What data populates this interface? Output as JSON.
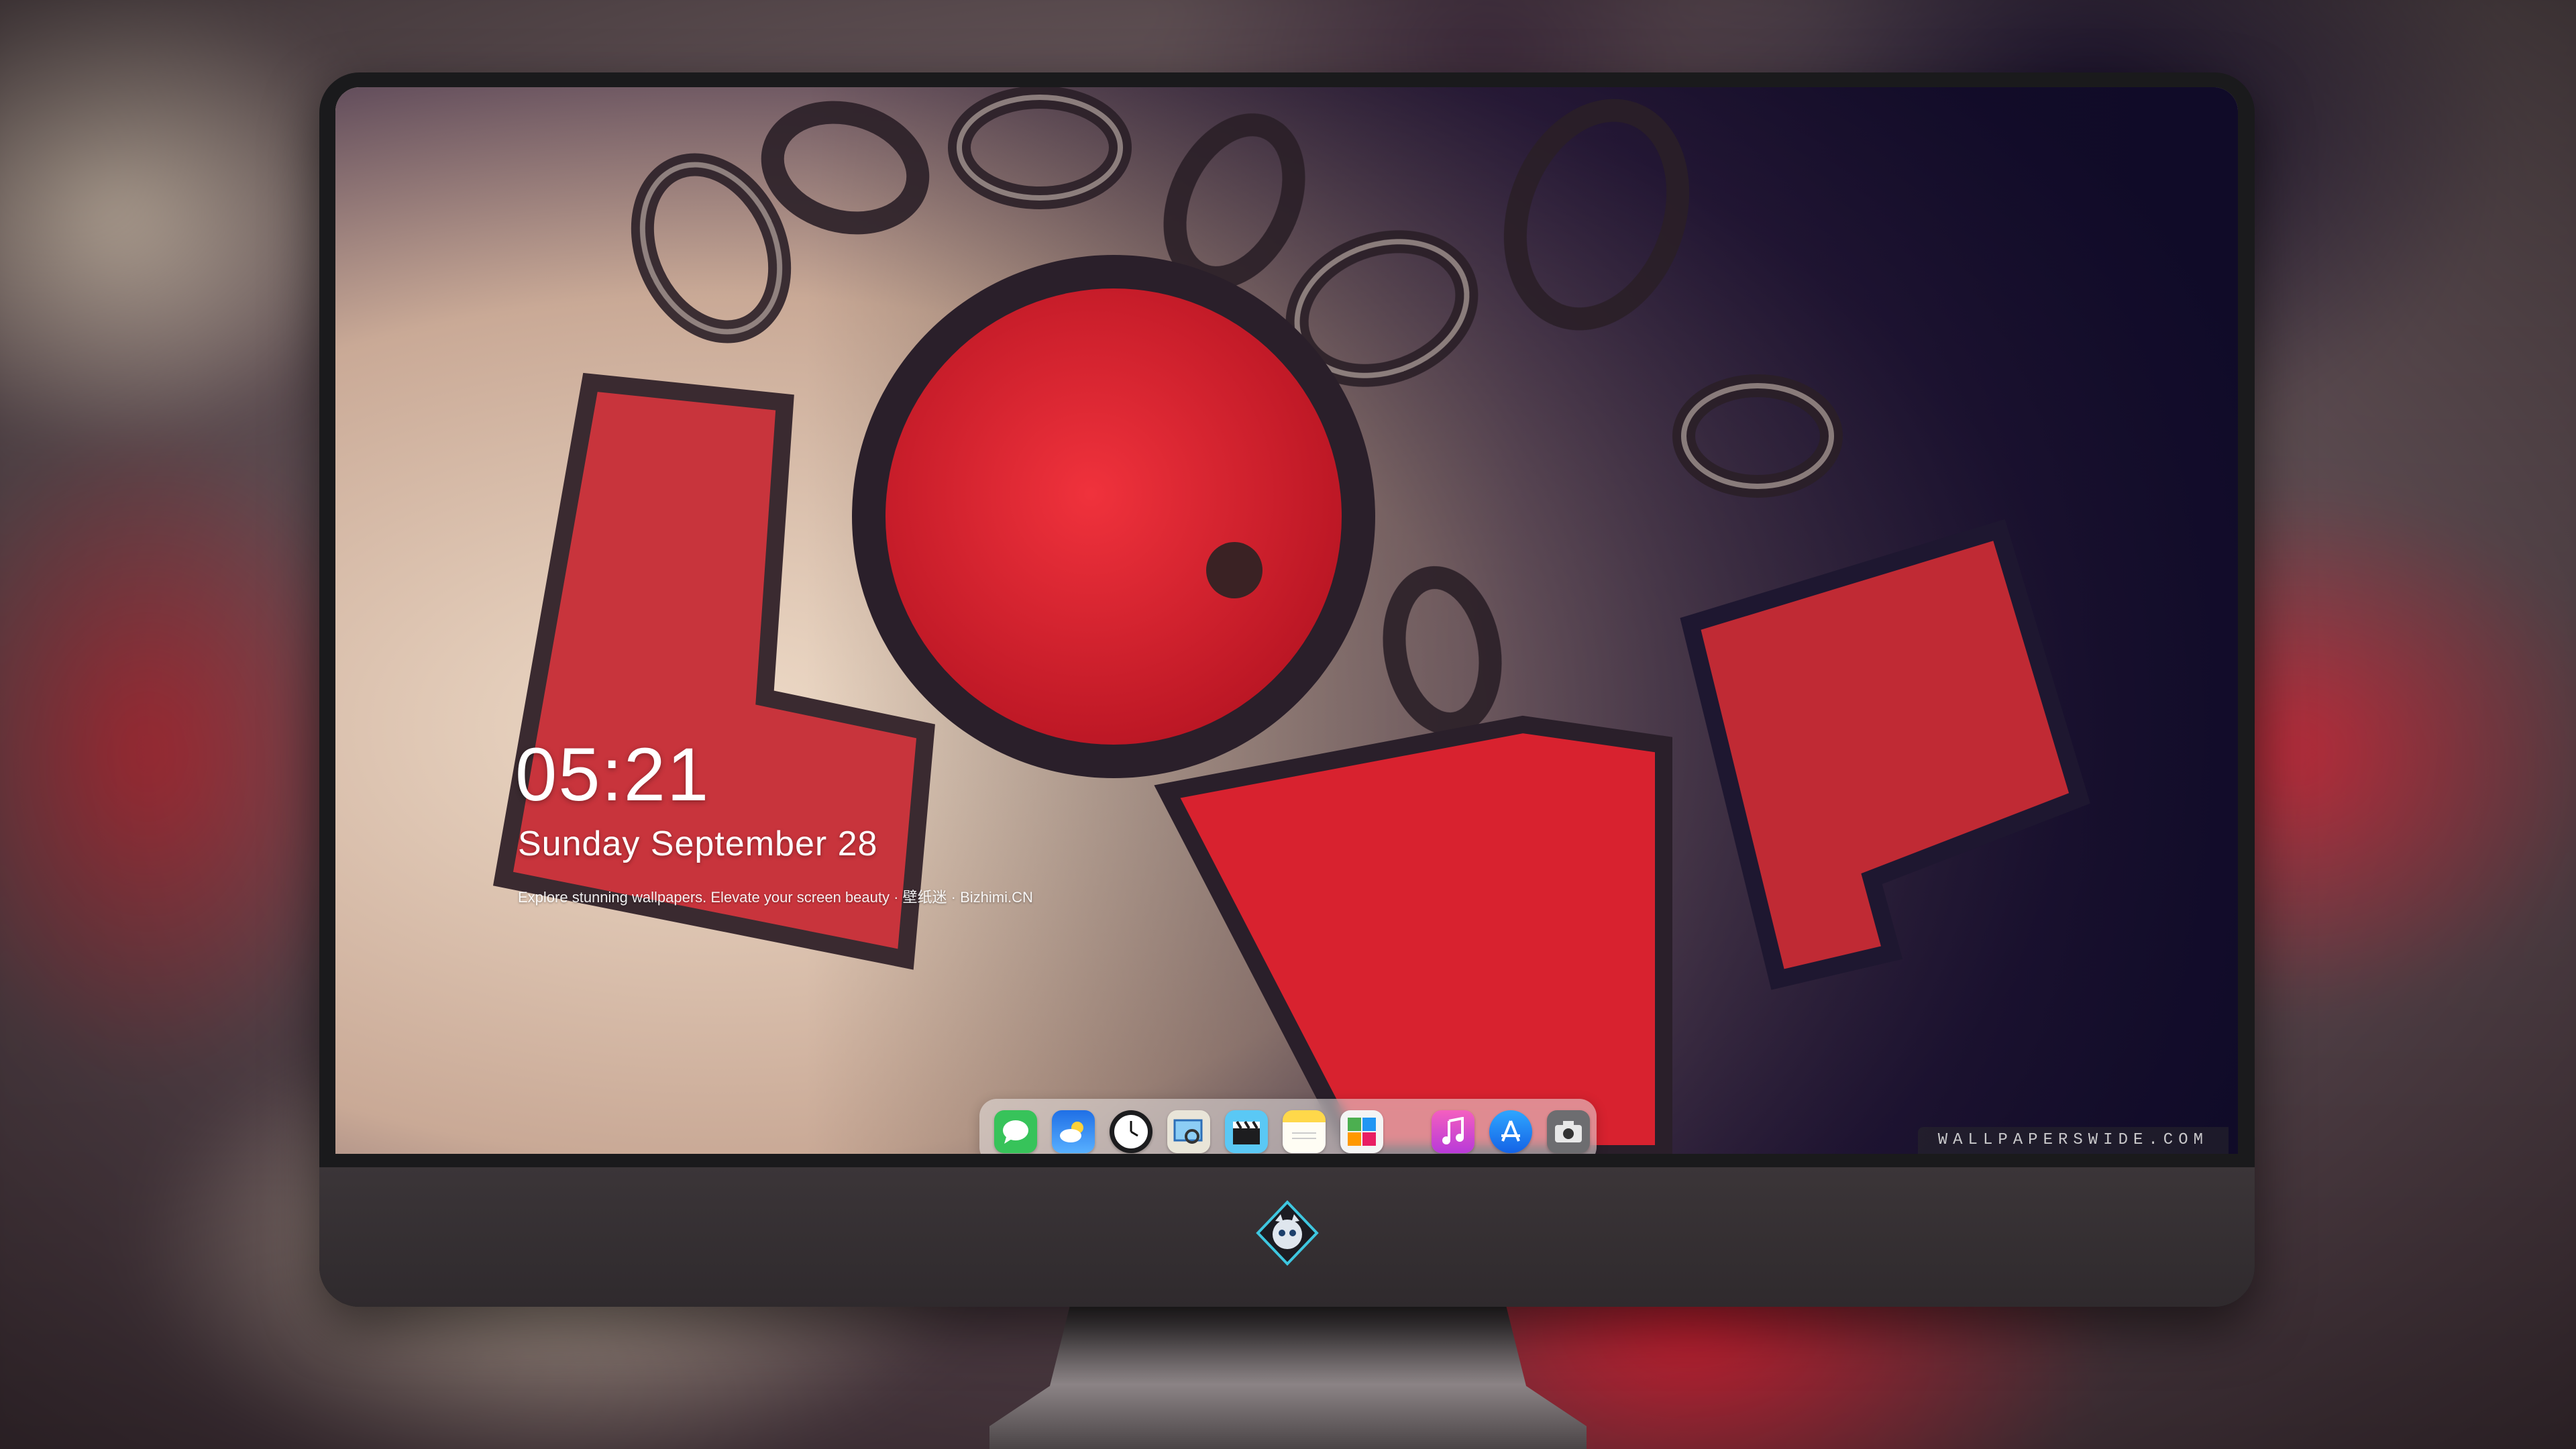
{
  "lock_screen": {
    "time": "05:21",
    "date": "Sunday September   28",
    "caption": "Explore stunning wallpapers. Elevate your screen beauty · 壁纸迷 · Bizhimi.CN"
  },
  "watermark": "WALLPAPERSWIDE.COM",
  "dock": {
    "apps": [
      {
        "name": "Messages",
        "icon": "messages-icon",
        "color": "#37c35a"
      },
      {
        "name": "Weather",
        "icon": "weather-icon",
        "color": "#3a8ef0"
      },
      {
        "name": "Clock",
        "icon": "clock-icon",
        "color": "#1c1c1e"
      },
      {
        "name": "Preview",
        "icon": "preview-icon",
        "color": "#e9e5d8"
      },
      {
        "name": "Clips",
        "icon": "clapperboard-icon",
        "color": "#5ac8f5"
      },
      {
        "name": "Notes",
        "icon": "notes-icon",
        "color": "#ffd84a"
      },
      {
        "name": "Photo Booth",
        "icon": "photo-booth-icon",
        "color": "#f4f4f4"
      },
      {
        "name": "iTunes",
        "icon": "music-icon",
        "color": "#e14fd4"
      },
      {
        "name": "App Store",
        "icon": "app-store-icon",
        "color": "#1e8cf3"
      },
      {
        "name": "Screenshot",
        "icon": "camera-icon",
        "color": "#6d6d70"
      }
    ]
  },
  "colors": {
    "chin": "#34302f",
    "bezel": "#1a1a1c",
    "accent_red": "#d8222f"
  }
}
